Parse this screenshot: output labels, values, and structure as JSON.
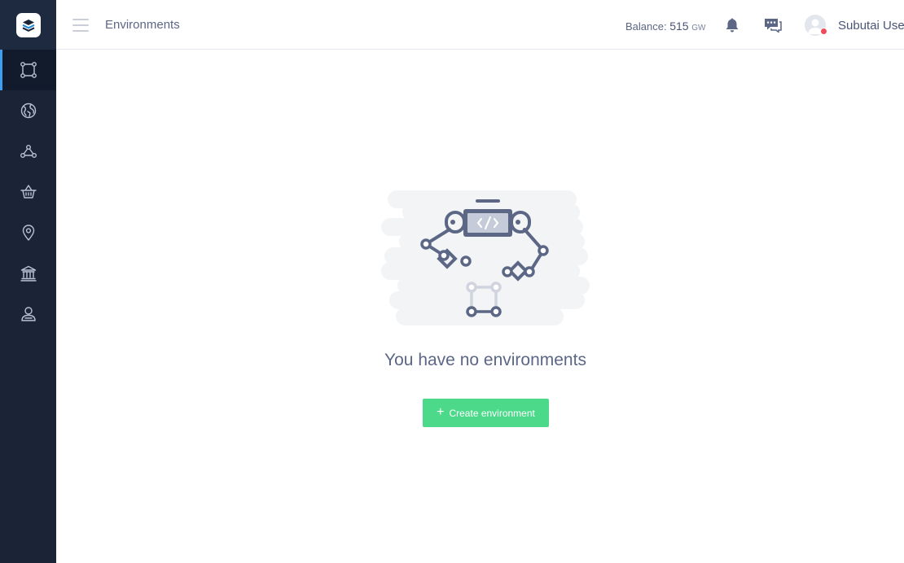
{
  "header": {
    "title": "Environments",
    "balance_label": "Balance:",
    "balance_amount": "515",
    "balance_unit": "GW",
    "user_name": "Subutai User",
    "user_status_color": "#f04b5a"
  },
  "sidebar": {
    "logo": "stack-logo",
    "items": [
      {
        "icon": "environments-icon",
        "active": true
      },
      {
        "icon": "globe-icon",
        "active": false
      },
      {
        "icon": "peers-network-icon",
        "active": false
      },
      {
        "icon": "basket-icon",
        "active": false
      },
      {
        "icon": "location-pin-icon",
        "active": false
      },
      {
        "icon": "bank-icon",
        "active": false
      },
      {
        "icon": "user-account-icon",
        "active": false
      }
    ]
  },
  "empty_state": {
    "message": "You have no environments",
    "button_label": "Create environment",
    "button_icon": "plus-icon"
  },
  "colors": {
    "sidebar_bg": "#1a2436",
    "active_indicator": "#3e9ff0",
    "primary_button": "#4cd98a",
    "text": "#5b6785"
  }
}
